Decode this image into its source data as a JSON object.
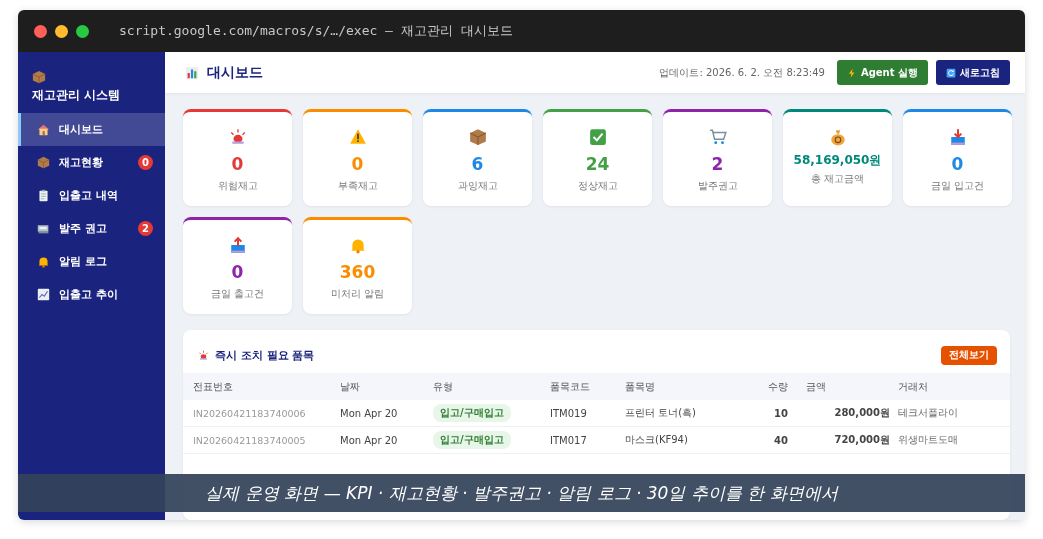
{
  "window": {
    "address": "script.google.com/macros/s/…/exec — 재고관리 대시보드"
  },
  "sidebar": {
    "title": "재고관리 시스템",
    "items": [
      {
        "label": "대시보드",
        "selected": true
      },
      {
        "label": "재고현황",
        "selected": false,
        "badge": "0"
      },
      {
        "label": "입출고 내역",
        "selected": false
      },
      {
        "label": "발주 권고",
        "selected": false,
        "badge": "2"
      },
      {
        "label": "알림 로그",
        "selected": false
      },
      {
        "label": "입출고 추이",
        "selected": false
      }
    ]
  },
  "header": {
    "title": "대시보드",
    "updated": "업데이트: 2026. 6. 2. 오전 8:23:49",
    "buttons": [
      {
        "label": "Agent 실행",
        "kind": "agent"
      },
      {
        "label": "새로고침",
        "kind": "refresh"
      }
    ]
  },
  "kpis": [
    {
      "value": "0",
      "label": "위험재고",
      "color": "#e53935",
      "kind": "count"
    },
    {
      "value": "0",
      "label": "부족재고",
      "color": "#fb8c00",
      "kind": "count"
    },
    {
      "value": "6",
      "label": "과잉재고",
      "color": "#1e88e5",
      "kind": "count"
    },
    {
      "value": "24",
      "label": "정상재고",
      "color": "#43a047",
      "kind": "count"
    },
    {
      "value": "2",
      "label": "발주권고",
      "color": "#8e24aa",
      "kind": "count"
    },
    {
      "value": "58,169,050원",
      "label": "총 재고금액",
      "color": "#00897b",
      "kind": "amount"
    },
    {
      "value": "0",
      "label": "금일 입고건",
      "color": "#1e88e5",
      "kind": "count"
    },
    {
      "value": "0",
      "label": "금일 출고건",
      "color": "#8e24aa",
      "kind": "count"
    },
    {
      "value": "360",
      "label": "미처리 알림",
      "color": "#fb8c00",
      "kind": "count"
    }
  ],
  "table": {
    "title": "즉시 조치 필요 품목",
    "button": "전체보기",
    "columns": [
      "전표번호",
      "날짜",
      "유형",
      "품목코드",
      "품목명",
      "수량",
      "금액",
      "거래처"
    ],
    "rows": [
      {
        "slip": "IN20260421183740006",
        "date": "Mon Apr 20",
        "type": "입고/구매입고",
        "code": "ITM019",
        "name": "프린터 토너(흑)",
        "qty": "10",
        "amount": "280,000원",
        "vendor": "테크서플라이"
      },
      {
        "slip": "IN20260421183740005",
        "date": "Mon Apr 20",
        "type": "입고/구매입고",
        "code": "ITM017",
        "name": "마스크(KF94)",
        "qty": "40",
        "amount": "720,000원",
        "vendor": "위생마트도매"
      }
    ]
  },
  "caption": "실제 운영 화면 — KPI · 재고현황 · 발주권고 · 알림 로그 · 30일 추이를 한 화면에서"
}
